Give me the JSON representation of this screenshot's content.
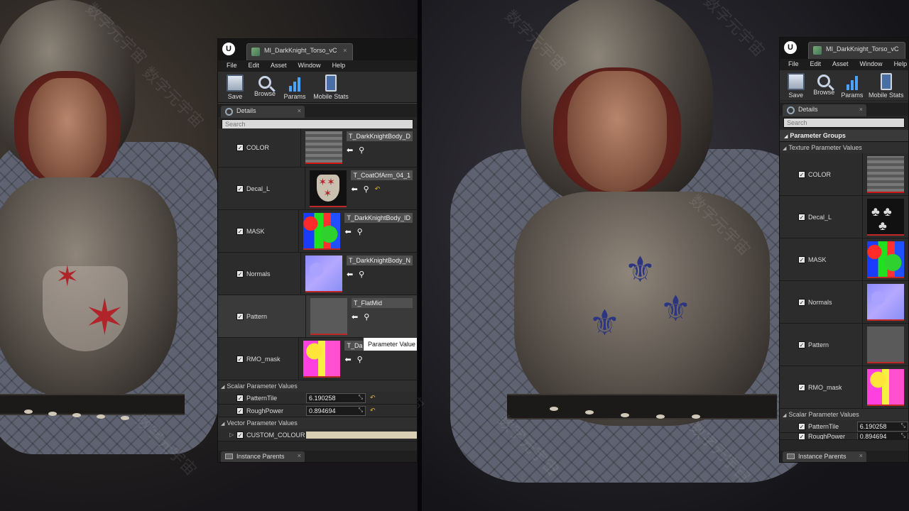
{
  "left_editor": {
    "tab_title": "MI_DarkKnight_Torso_vC",
    "menu": [
      "File",
      "Edit",
      "Asset",
      "Window",
      "Help"
    ],
    "toolbar": [
      "Save",
      "Browse",
      "Params",
      "Mobile Stats"
    ],
    "details_tab": "Details",
    "search_placeholder": "Search",
    "textures": [
      {
        "label": "COLOR",
        "value": "T_DarkKnightBody_D"
      },
      {
        "label": "Decal_L",
        "value": "T_CoatOfArm_04_1"
      },
      {
        "label": "MASK",
        "value": "T_DarkKnightBody_ID"
      },
      {
        "label": "Normals",
        "value": "T_DarkKnightBody_N"
      },
      {
        "label": "Pattern",
        "value": "T_FlatMid"
      },
      {
        "label": "RMO_mask",
        "value": "T_DarkKnightBody_…"
      }
    ],
    "scalar_header": "Scalar Parameter Values",
    "scalars": [
      {
        "label": "PatternTile",
        "value": "6.190258"
      },
      {
        "label": "RoughPower",
        "value": "0.894694"
      }
    ],
    "vector_header": "Vector Parameter Values",
    "vectors": [
      {
        "label": "CUSTOM_COLOUR A"
      }
    ],
    "tooltip": "Parameter Value",
    "bottom_tab": "Instance Parents"
  },
  "right_editor": {
    "tab_title": "MI_DarkKnight_Torso_vC",
    "menu": [
      "File",
      "Edit",
      "Asset",
      "Window",
      "Help"
    ],
    "toolbar": [
      "Save",
      "Browse",
      "Params",
      "Mobile Stats"
    ],
    "details_tab": "Details",
    "search_placeholder": "Search",
    "parameter_groups": "Parameter Groups",
    "texture_header": "Texture Parameter Values",
    "textures": [
      {
        "label": "COLOR"
      },
      {
        "label": "Decal_L"
      },
      {
        "label": "MASK"
      },
      {
        "label": "Normals"
      },
      {
        "label": "Pattern"
      },
      {
        "label": "RMO_mask"
      }
    ],
    "scalar_header": "Scalar Parameter Values",
    "scalars": [
      {
        "label": "PatternTile",
        "value": "6.190258"
      },
      {
        "label": "RoughPower",
        "value": "0.894694"
      }
    ],
    "bottom_tab": "Instance Parents"
  },
  "watermark_text": "数字元宇宙",
  "colors": {
    "accent_red": "#c02828",
    "reset_yellow": "#e0b030",
    "decal_star_red": "#b0242a",
    "fleur_blue": "#2c3580"
  }
}
